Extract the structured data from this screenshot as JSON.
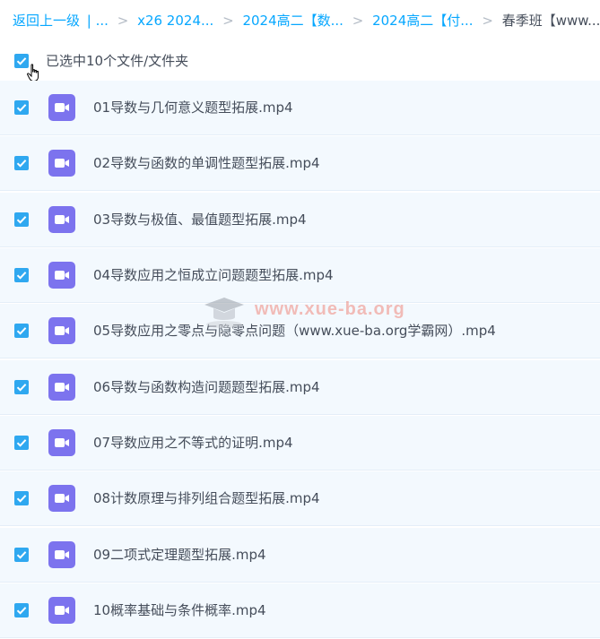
{
  "breadcrumb": {
    "items": [
      {
        "label": "返回上一级"
      },
      {
        "label": "| ..."
      },
      {
        "label": "x26 2024..."
      },
      {
        "label": "2024高二【数..."
      },
      {
        "label": "2024高二【付..."
      },
      {
        "label": "春季班【www...."
      }
    ],
    "separator": ">"
  },
  "selection": {
    "label": "已选中10个文件/文件夹",
    "checked": true
  },
  "files": [
    {
      "name": "01导数与几何意义题型拓展.mp4",
      "checked": true,
      "icon": "video-icon"
    },
    {
      "name": "02导数与函数的单调性题型拓展.mp4",
      "checked": true,
      "icon": "video-icon"
    },
    {
      "name": "03导数与极值、最值题型拓展.mp4",
      "checked": true,
      "icon": "video-icon"
    },
    {
      "name": "04导数应用之恒成立问题题型拓展.mp4",
      "checked": true,
      "icon": "video-icon"
    },
    {
      "name": "05导数应用之零点与隐零点问题（www.xue-ba.org学霸网）.mp4",
      "checked": true,
      "icon": "video-icon"
    },
    {
      "name": "06导数与函数构造问题题型拓展.mp4",
      "checked": true,
      "icon": "video-icon"
    },
    {
      "name": "07导数应用之不等式的证明.mp4",
      "checked": true,
      "icon": "video-icon"
    },
    {
      "name": "08计数原理与排列组合题型拓展.mp4",
      "checked": true,
      "icon": "video-icon"
    },
    {
      "name": "09二项式定理题型拓展.mp4",
      "checked": true,
      "icon": "video-icon"
    },
    {
      "name": "10概率基础与条件概率.mp4",
      "checked": true,
      "icon": "video-icon"
    }
  ],
  "watermark": {
    "text": "www.xue-ba.org"
  },
  "colors": {
    "accent": "#06a7ff",
    "checkbox": "#2fa8f0",
    "video_icon": "#7c73ee",
    "row_bg": "#f3f9fe",
    "text": "#454d5a"
  }
}
